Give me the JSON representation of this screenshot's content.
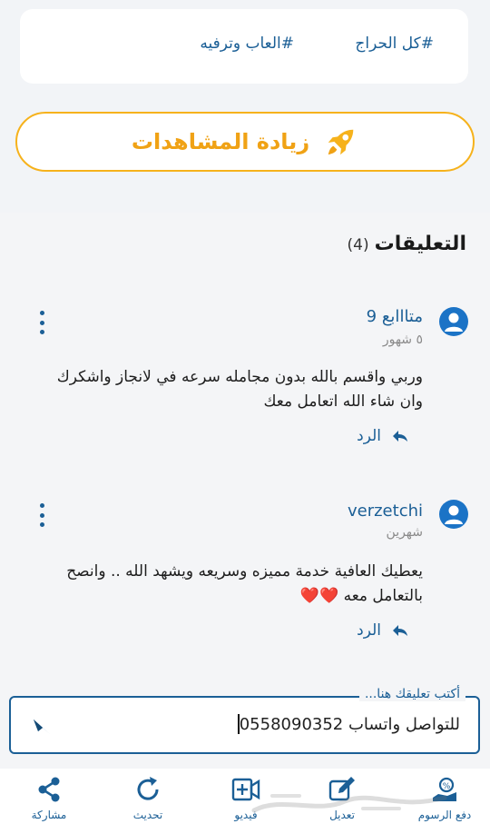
{
  "tags": [
    "#كل الحراج",
    "#العاب وترفيه"
  ],
  "boost": {
    "label": "زيادة المشاهدات"
  },
  "comments_header": {
    "title": "التعليقات",
    "count": "(4)"
  },
  "comments": [
    {
      "name": "متااابع 9",
      "time": "٥ شهور",
      "body_line1": "وربي واقسم بالله بدون مجامله سرعه في لانجاز واشكرك",
      "body_line2": "وان شاء الله اتعامل معك",
      "reply_label": "الرد"
    },
    {
      "name": "verzetchi",
      "time": "شهرين",
      "body_line1": "يعطيك العافية خدمة مميزه وسريعه ويشهد الله .. وانصح",
      "body_line2": "بالتعامل معه ❤️❤️",
      "reply_label": "الرد"
    }
  ],
  "comment_input": {
    "legend": "أكتب تعليقك هنا...",
    "value": "للتواصل واتساب 0558090352"
  },
  "bottom_nav": [
    {
      "label": "دفع الرسوم",
      "icon": "fee-payment-icon"
    },
    {
      "label": "تعديل",
      "icon": "edit-icon"
    },
    {
      "label": "فيديو",
      "icon": "video-add-icon"
    },
    {
      "label": "تحديث",
      "icon": "refresh-icon"
    },
    {
      "label": "مشاركة",
      "icon": "share-icon"
    }
  ],
  "colors": {
    "primary": "#1b5f96",
    "accent": "#f6b21c",
    "heart": "#e53935"
  }
}
